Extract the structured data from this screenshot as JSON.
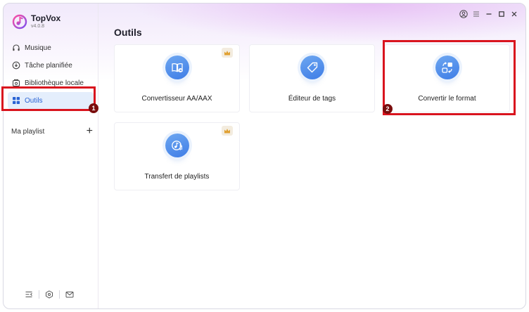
{
  "app": {
    "name": "TopVox",
    "version": "v4.0.8"
  },
  "sidebar": {
    "items": [
      {
        "label": "Musique",
        "icon": "headphones-icon"
      },
      {
        "label": "Tâche planifiée",
        "icon": "clock-download-icon"
      },
      {
        "label": "Bibliothèque locale",
        "icon": "local-library-icon"
      },
      {
        "label": "Outils",
        "icon": "grid-icon",
        "active": true
      }
    ],
    "playlist_label": "Ma playlist",
    "add_playlist_symbol": "+"
  },
  "main": {
    "title": "Outils",
    "tools": [
      {
        "label": "Convertisseur AA/AAX",
        "icon": "audiobook-convert-icon",
        "premium": true
      },
      {
        "label": "Éditeur de tags",
        "icon": "tag-icon",
        "premium": false
      },
      {
        "label": "Convertir le format",
        "icon": "format-convert-icon",
        "premium": false
      },
      {
        "label": "Transfert de playlists",
        "icon": "playlist-transfer-icon",
        "premium": true
      }
    ]
  },
  "annotations": [
    {
      "number": "1",
      "target": "Outils"
    },
    {
      "number": "2",
      "target": "Convertir le format"
    }
  ],
  "colors": {
    "accent": "#3f7de6",
    "highlight": "#d9141e",
    "badge": "#7a0d0d",
    "crown": "#e0a030"
  }
}
